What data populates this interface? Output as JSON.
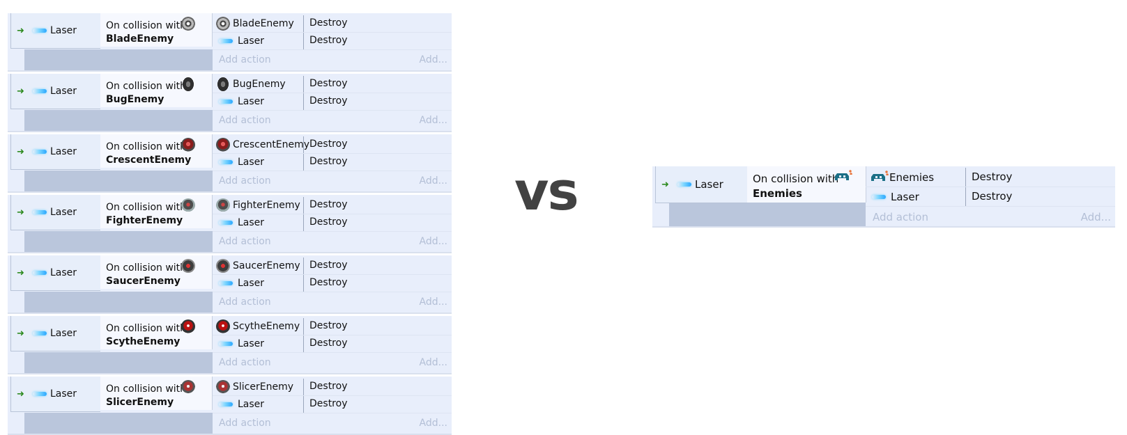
{
  "left_events": [
    {
      "condition_object": "Laser",
      "trigger_prefix": "On collision with",
      "target": "BladeEnemy",
      "target_icon": "blade-enemy-icon",
      "actions": [
        {
          "object": "BladeEnemy",
          "action": "Destroy"
        },
        {
          "object": "Laser",
          "action": "Destroy"
        }
      ]
    },
    {
      "condition_object": "Laser",
      "trigger_prefix": "On collision with",
      "target": "BugEnemy",
      "target_icon": "bug-enemy-icon",
      "actions": [
        {
          "object": "BugEnemy",
          "action": "Destroy"
        },
        {
          "object": "Laser",
          "action": "Destroy"
        }
      ]
    },
    {
      "condition_object": "Laser",
      "trigger_prefix": "On collision with",
      "target": "CrescentEnemy",
      "target_icon": "crescent-enemy-icon",
      "actions": [
        {
          "object": "CrescentEnemy",
          "action": "Destroy"
        },
        {
          "object": "Laser",
          "action": "Destroy"
        }
      ]
    },
    {
      "condition_object": "Laser",
      "trigger_prefix": "On collision with",
      "target": "FighterEnemy",
      "target_icon": "fighter-enemy-icon",
      "actions": [
        {
          "object": "FighterEnemy",
          "action": "Destroy"
        },
        {
          "object": "Laser",
          "action": "Destroy"
        }
      ]
    },
    {
      "condition_object": "Laser",
      "trigger_prefix": "On collision with",
      "target": "SaucerEnemy",
      "target_icon": "saucer-enemy-icon",
      "actions": [
        {
          "object": "SaucerEnemy",
          "action": "Destroy"
        },
        {
          "object": "Laser",
          "action": "Destroy"
        }
      ]
    },
    {
      "condition_object": "Laser",
      "trigger_prefix": "On collision with",
      "target": "ScytheEnemy",
      "target_icon": "scythe-enemy-icon",
      "actions": [
        {
          "object": "ScytheEnemy",
          "action": "Destroy"
        },
        {
          "object": "Laser",
          "action": "Destroy"
        }
      ]
    },
    {
      "condition_object": "Laser",
      "trigger_prefix": "On collision with",
      "target": "SlicerEnemy",
      "target_icon": "slicer-enemy-icon",
      "actions": [
        {
          "object": "SlicerEnemy",
          "action": "Destroy"
        },
        {
          "object": "Laser",
          "action": "Destroy"
        }
      ]
    }
  ],
  "add_action_label": "Add action",
  "add_more_label": "Add...",
  "vs_label": "vs",
  "right_event": {
    "condition_object": "Laser",
    "trigger_prefix": "On collision with",
    "target": "Enemies",
    "target_icon": "enemies-family-icon",
    "actions": [
      {
        "object": "Enemies",
        "action": "Destroy"
      },
      {
        "object": "Laser",
        "action": "Destroy"
      }
    ]
  },
  "colors": {
    "event_bg": "#e8eefb",
    "condition_strip": "#bac6dc",
    "trigger_cell": "#f6f8fe",
    "add_text": "#b3bfd6",
    "arrow": "#2e8b20",
    "vs_text": "#424242"
  }
}
